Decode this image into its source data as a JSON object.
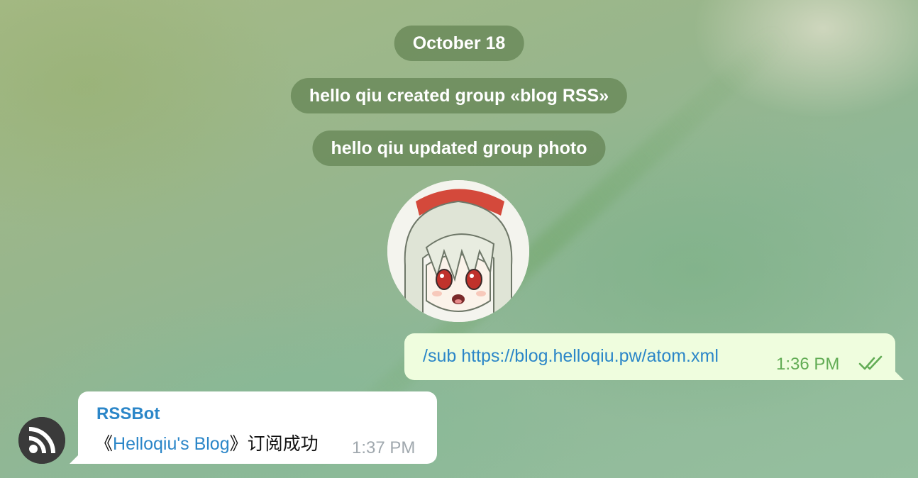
{
  "service_messages": {
    "date": "October 18",
    "created": "hello qiu created group «blog RSS»",
    "photo_updated": "hello qiu updated group photo"
  },
  "outgoing_message": {
    "text": "/sub https://blog.helloqiu.pw/atom.xml",
    "time": "1:36 PM",
    "status": "read"
  },
  "incoming_message": {
    "sender": "RSSBot",
    "open_bracket": "《",
    "link_text": "Helloqiu's Blog",
    "close_text": "》订阅成功",
    "time": "1:37 PM"
  },
  "colors": {
    "link": "#2b86c8",
    "outgoing_bubble": "#effdde",
    "read_check": "#62ac55",
    "service_pill": "#62824f"
  },
  "icons": {
    "read_status": "double-check-icon",
    "bot_avatar": "rss-feed-icon"
  }
}
